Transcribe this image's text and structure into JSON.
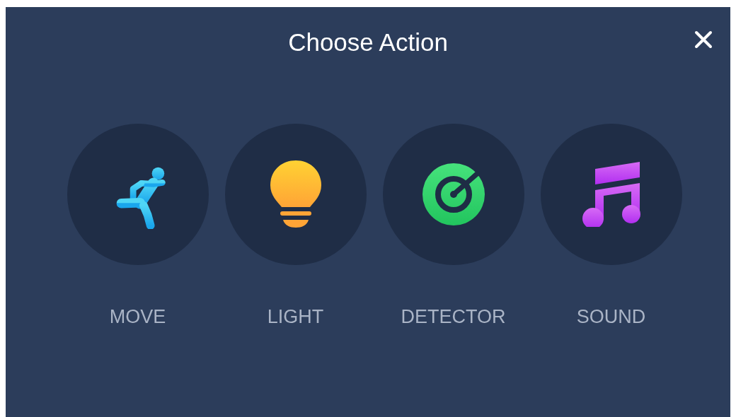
{
  "dialog": {
    "title": "Choose Action",
    "actions": [
      {
        "kind": "move",
        "label": "MOVE"
      },
      {
        "kind": "light",
        "label": "LIGHT"
      },
      {
        "kind": "detector",
        "label": "DETECTOR"
      },
      {
        "kind": "sound",
        "label": "SOUND"
      }
    ]
  }
}
